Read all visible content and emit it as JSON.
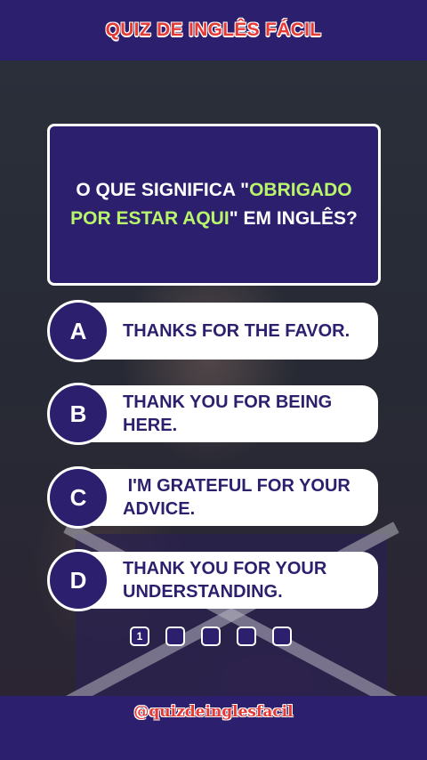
{
  "header": {
    "title": "QUIZ DE INGLÊS FÁCIL"
  },
  "question": {
    "prefix": "O QUE SIGNIFICA \"",
    "highlight": "OBRIGADO POR ESTAR AQUI",
    "suffix": "\" EM INGLÊS?"
  },
  "options": [
    {
      "letter": "A",
      "text": "THANKS FOR THE FAVOR."
    },
    {
      "letter": "B",
      "text": "THANK YOU FOR BEING HERE."
    },
    {
      "letter": "C",
      "text": " I'M GRATEFUL FOR YOUR ADVICE."
    },
    {
      "letter": "D",
      "text": "THANK YOU FOR YOUR UNDERSTANDING."
    }
  ],
  "pager": {
    "pages": [
      "1",
      "",
      "",
      "",
      ""
    ],
    "current": 1
  },
  "footer": {
    "handle": "@quizdeinglesfacil"
  },
  "colors": {
    "primary": "#2c1f6e",
    "highlight": "#b9f56b",
    "brand_red": "#e53935"
  }
}
